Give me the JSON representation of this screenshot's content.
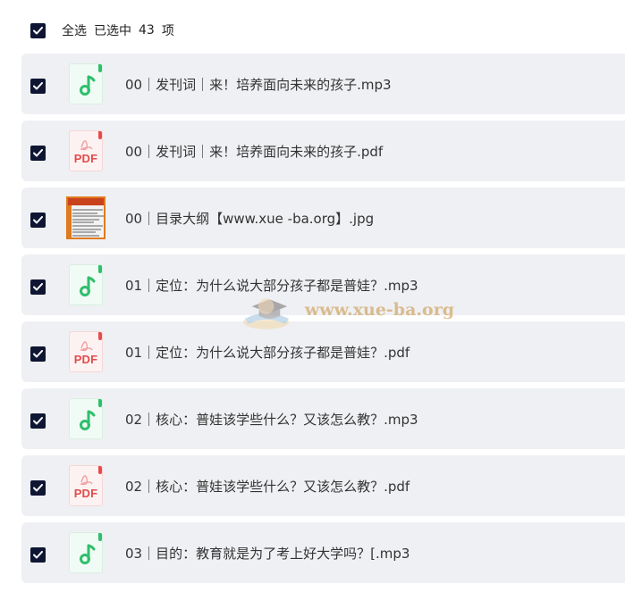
{
  "header": {
    "select_all_label": "全选",
    "selected_label": "已选中",
    "selected_count": "43",
    "items_unit": "项",
    "checked": true
  },
  "files": [
    {
      "name": "00｜发刊词｜来！培养面向未来的孩子.mp3",
      "type": "audio",
      "checked": true
    },
    {
      "name": "00｜发刊词｜来！培养面向未来的孩子.pdf",
      "type": "pdf",
      "checked": true
    },
    {
      "name": "00｜目录大纲【www.xue -ba.org】.jpg",
      "type": "image",
      "checked": true
    },
    {
      "name": "01｜定位：为什么说大部分孩子都是普娃？.mp3",
      "type": "audio",
      "checked": true
    },
    {
      "name": "01｜定位：为什么说大部分孩子都是普娃？.pdf",
      "type": "pdf",
      "checked": true
    },
    {
      "name": "02｜核心：普娃该学些什么？又该怎么教？.mp3",
      "type": "audio",
      "checked": true
    },
    {
      "name": "02｜核心：普娃该学些什么？又该怎么教？.pdf",
      "type": "pdf",
      "checked": true
    },
    {
      "name": "03｜目的：教育就是为了考上好大学吗？[.mp3",
      "type": "audio",
      "checked": true
    }
  ],
  "pdf_icon_text": "PDF",
  "watermark": {
    "text": "www.xue-ba.org"
  },
  "colors": {
    "checkbox": "#0f1633",
    "row_background": "#eff0f3",
    "audio_accent": "#2fbf6c",
    "pdf_accent": "#e34b4b",
    "watermark": "#c8913a"
  },
  "icons": {
    "audio": "music-note-icon",
    "pdf": "pdf-file-icon",
    "image": "image-thumbnail-icon",
    "checkbox": "checkmark-icon"
  }
}
